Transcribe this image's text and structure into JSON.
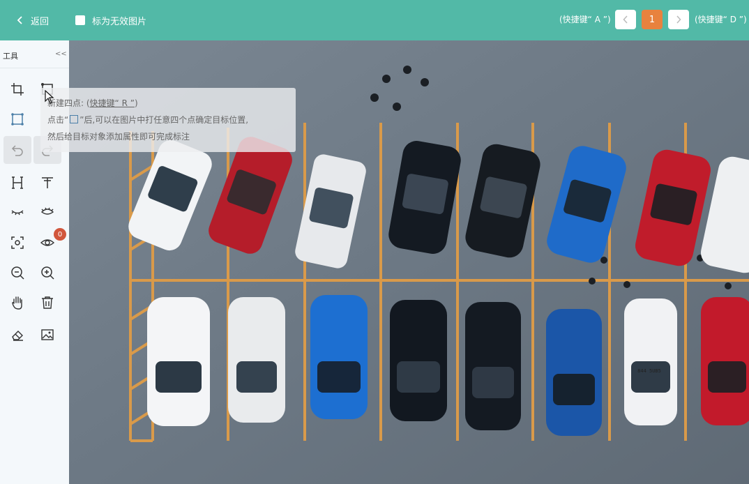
{
  "topbar": {
    "back_label": "返回",
    "invalid_label": "标为无效图片",
    "prev_hint": "(快捷键“ A ”)",
    "next_hint": "(快捷键“ D ”)",
    "page_number": "1",
    "background_color": "#52b9a7",
    "page_color": "#e8823e"
  },
  "sidebar": {
    "title": "工具",
    "collapse_label": "<<",
    "badge_count": "0",
    "tools": [
      "crop-icon",
      "new-four-point-icon",
      "rectangle-icon",
      "undo-icon",
      "redo-icon",
      "h-measure-icon",
      "text-icon",
      "eye-closed-icon",
      "eye-lashes-icon",
      "focus-icon",
      "eye-icon",
      "zoom-out-icon",
      "zoom-in-icon",
      "hand-icon",
      "delete-icon",
      "eraser-icon",
      "image-icon"
    ]
  },
  "tooltip": {
    "line1_prefix": "新建四点: (",
    "line1_key": "快捷键“ R ”",
    "line1_suffix": ")",
    "line2_prefix": "点击“",
    "line2_suffix": "”后,可以在图片中打任意四个点确定目标位置,",
    "line3": "然后给目标对象添加属性即可完成标注"
  },
  "canvas": {
    "plate_text": "844 5UB5"
  }
}
